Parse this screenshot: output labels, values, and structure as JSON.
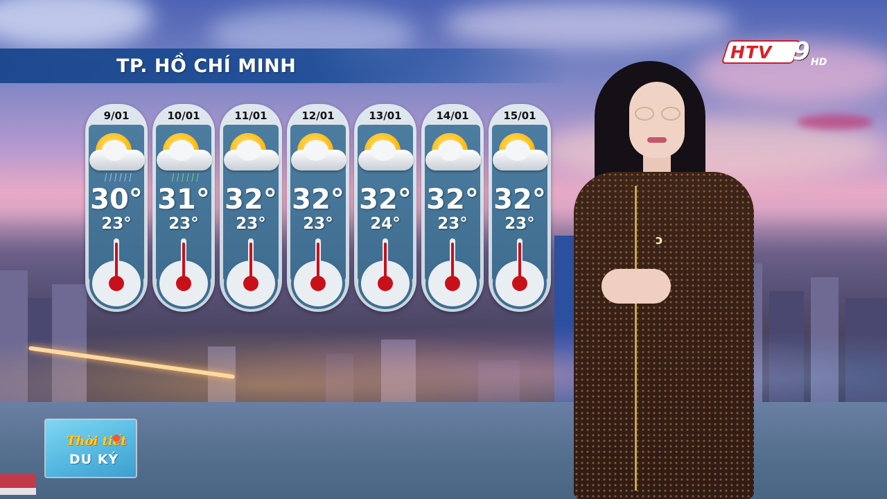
{
  "location": "TP. HỒ CHÍ MINH",
  "channel_logo": {
    "htv": "HTV",
    "nine": "9",
    "hd": "HD"
  },
  "program_logo": {
    "line1": "Thời tiết",
    "line2": "DU KÝ"
  },
  "forecast": [
    {
      "date": "9/01",
      "high": "30°",
      "low": "23°",
      "icon": "sun-cloud-rain-icon"
    },
    {
      "date": "10/01",
      "high": "31°",
      "low": "23°",
      "icon": "sun-cloud-rain-icon"
    },
    {
      "date": "11/01",
      "high": "32°",
      "low": "23°",
      "icon": "sun-cloud-icon"
    },
    {
      "date": "12/01",
      "high": "32°",
      "low": "23°",
      "icon": "sun-cloud-icon"
    },
    {
      "date": "13/01",
      "high": "32°",
      "low": "24°",
      "icon": "sun-cloud-icon"
    },
    {
      "date": "14/01",
      "high": "32°",
      "low": "23°",
      "icon": "sun-cloud-icon"
    },
    {
      "date": "15/01",
      "high": "32°",
      "low": "23°",
      "icon": "sun-cloud-icon"
    }
  ],
  "colors": {
    "banner": "#1c4c96",
    "thermometer": "#c8101a",
    "card_inner": "#4c7da0",
    "logo_red": "#d9202a"
  }
}
